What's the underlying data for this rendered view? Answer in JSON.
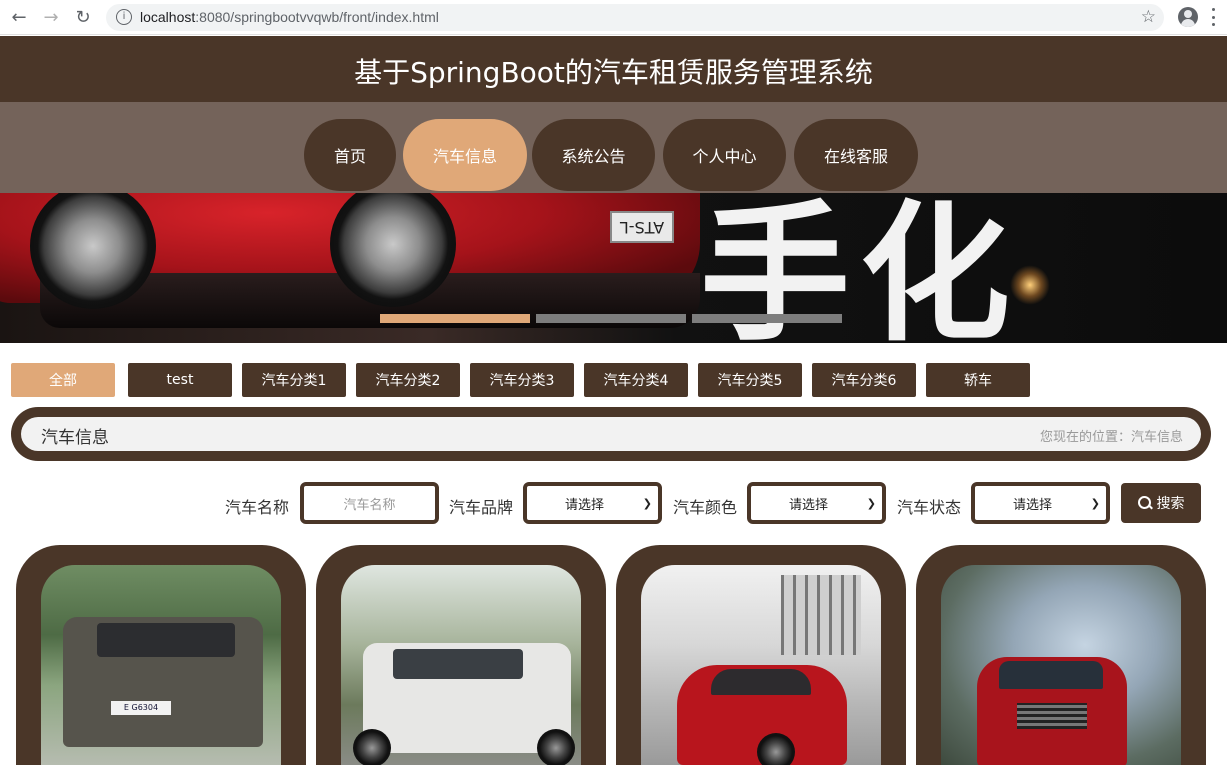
{
  "browser": {
    "url_host": "localhost",
    "url_rest": ":8080/springbootvvqwb/front/index.html"
  },
  "site": {
    "title": "基于SpringBoot的汽车租赁服务管理系统"
  },
  "nav": [
    {
      "label": "首页",
      "active": false
    },
    {
      "label": "汽车信息",
      "active": true
    },
    {
      "label": "系统公告",
      "active": false
    },
    {
      "label": "个人中心",
      "active": false
    },
    {
      "label": "在线客服",
      "active": false
    }
  ],
  "banner": {
    "plate": "ATS-L",
    "brush_text": "手化",
    "slide_count": 3,
    "active_slide": 1
  },
  "categories": [
    "全部",
    "test",
    "汽车分类1",
    "汽车分类2",
    "汽车分类3",
    "汽车分类4",
    "汽车分类5",
    "汽车分类6",
    "轿车"
  ],
  "active_category": "全部",
  "breadcrumb": {
    "title": "汽车信息",
    "location": "您现在的位置：汽车信息"
  },
  "search": {
    "name_label": "汽车名称",
    "name_placeholder": "汽车名称",
    "brand_label": "汽车品牌",
    "brand_value": "请选择",
    "color_label": "汽车颜色",
    "color_value": "请选择",
    "status_label": "汽车状态",
    "status_value": "请选择",
    "button_label": "搜索"
  },
  "cards": [
    {
      "plate": "E G6304",
      "car_color": "#4a4a44"
    },
    {
      "car_color": "#e4e4e2"
    },
    {
      "car_color": "#b8151d"
    },
    {
      "car_color": "#a8141c"
    }
  ],
  "colors": {
    "brown": "#4a3628",
    "nav_bg": "#74635a",
    "accent": "#e0a878"
  }
}
